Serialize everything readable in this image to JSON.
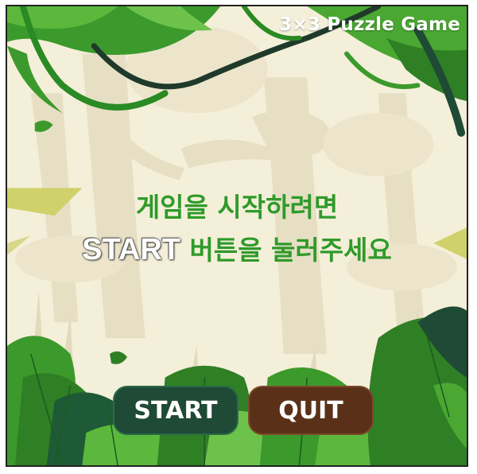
{
  "game": {
    "title": "3×3 Puzzle Game"
  },
  "message": {
    "line1": "게임을 시작하려면",
    "line2_start_word": "START",
    "line2_rest": " 버튼을 눌러주세요"
  },
  "buttons": {
    "start_label": "START",
    "quit_label": "QUIT"
  },
  "colors": {
    "background": "#f4efd9",
    "message_green": "#2f9a2a",
    "start_button": "#1f4a36",
    "quit_button": "#5a3118"
  },
  "scene": {
    "theme": "jungle",
    "elements": [
      "tree-trunks",
      "hanging-vines",
      "foreground-leaves",
      "falling-leaves"
    ]
  }
}
